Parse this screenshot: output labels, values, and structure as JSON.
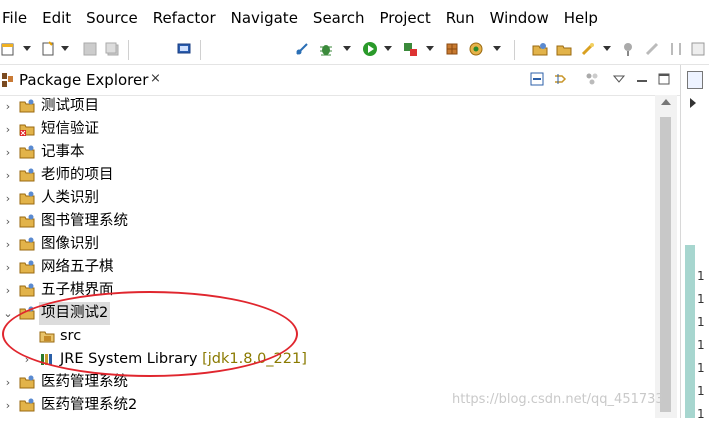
{
  "menubar": {
    "items": [
      "File",
      "Edit",
      "Source",
      "Refactor",
      "Navigate",
      "Search",
      "Project",
      "Run",
      "Window",
      "Help"
    ]
  },
  "view": {
    "title": "Package Explorer",
    "close_glyph": "⨯"
  },
  "tree": {
    "items": [
      {
        "label": "测试项目",
        "icon": "project-folder-icon",
        "expanded": false
      },
      {
        "label": "短信验证",
        "icon": "project-error-icon",
        "expanded": false
      },
      {
        "label": "记事本",
        "icon": "project-folder-icon",
        "expanded": false
      },
      {
        "label": "老师的项目",
        "icon": "project-folder-icon",
        "expanded": false
      },
      {
        "label": "人类识别",
        "icon": "project-folder-icon",
        "expanded": false
      },
      {
        "label": "图书管理系统",
        "icon": "project-folder-icon",
        "expanded": false
      },
      {
        "label": "图像识别",
        "icon": "project-folder-icon",
        "expanded": false
      },
      {
        "label": "网络五子棋",
        "icon": "project-folder-icon",
        "expanded": false
      },
      {
        "label": "五子棋界面",
        "icon": "project-folder-icon",
        "expanded": false
      },
      {
        "label": "项目测试2",
        "icon": "project-folder-icon",
        "expanded": true,
        "selected": true
      },
      {
        "label": "src",
        "icon": "source-folder-icon",
        "child": true
      },
      {
        "label": "JRE System Library",
        "decoration": "[jdk1.8.0_221]",
        "icon": "library-icon",
        "child": true
      },
      {
        "label": "医药管理系统",
        "icon": "project-folder-icon",
        "expanded": false
      },
      {
        "label": "医药管理系统2",
        "icon": "project-folder-icon",
        "expanded": false
      }
    ]
  },
  "editor": {
    "line_numbers": [
      "1",
      "1",
      "1",
      "1",
      "1",
      "1",
      "1"
    ]
  },
  "watermark": "https://blog.csdn.net/qq_451733",
  "colors": {
    "annotation": "#e0262e",
    "selection": "#dcdcdc",
    "decoration": "#8a7a00"
  }
}
